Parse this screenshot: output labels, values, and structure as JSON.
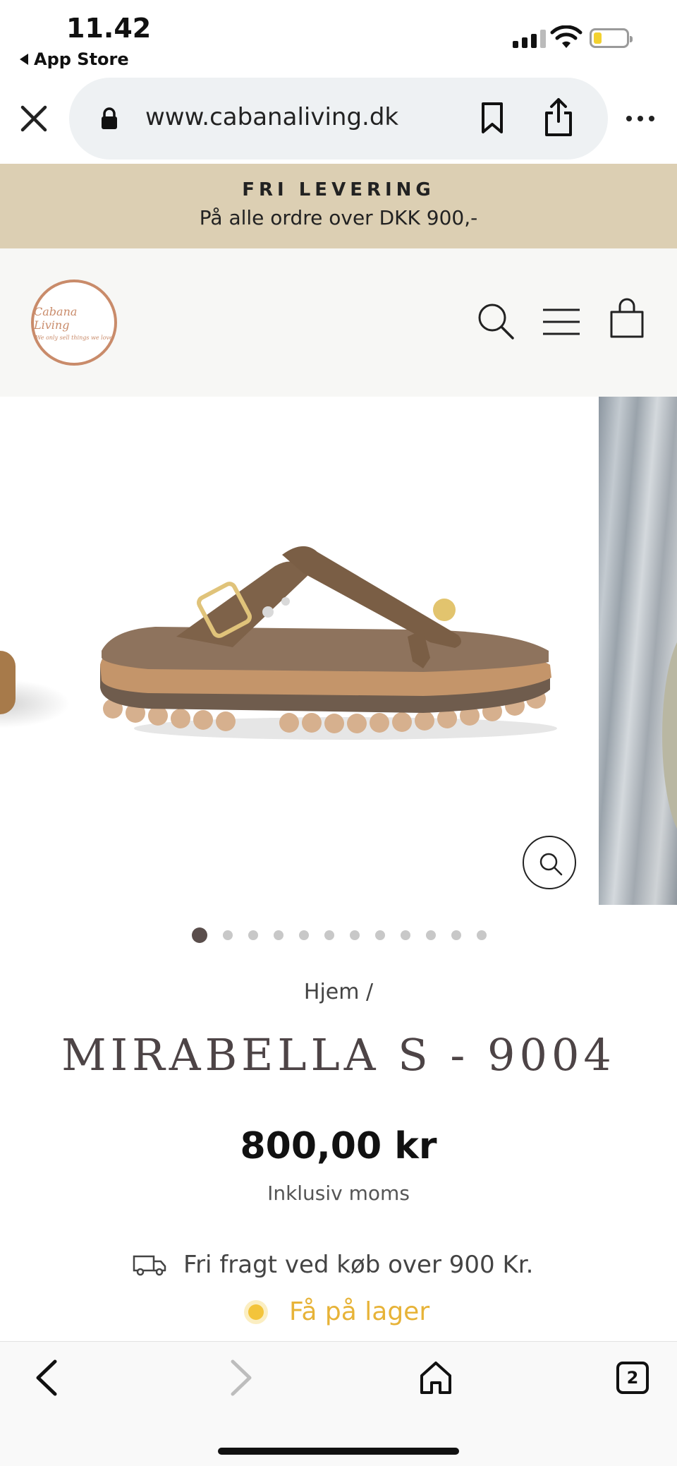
{
  "status_bar": {
    "time": "11.42",
    "back_label": "App Store"
  },
  "browser": {
    "url": "www.cabanaliving.dk"
  },
  "promo": {
    "title": "FRI LEVERING",
    "subtitle": "På alle ordre over DKK 900,-"
  },
  "header": {
    "logo_name": "Cabana Living",
    "logo_tagline": "We only sell things we love"
  },
  "gallery": {
    "slide_count": 12,
    "active_slide": 1
  },
  "product": {
    "breadcrumb": "Hjem /",
    "title": "MIRABELLA S - 9004",
    "price": "800,00 kr",
    "tax_note": "Inklusiv moms",
    "shipping_text": "Fri fragt ved køb over 900 Kr.",
    "stock_text": "Få på lager"
  },
  "toolbar": {
    "tab_count": "2"
  },
  "colors": {
    "promo_bg": "#dccfb3",
    "logo": "#c98b6a",
    "title": "#4d4446",
    "stock": "#e7b338"
  }
}
